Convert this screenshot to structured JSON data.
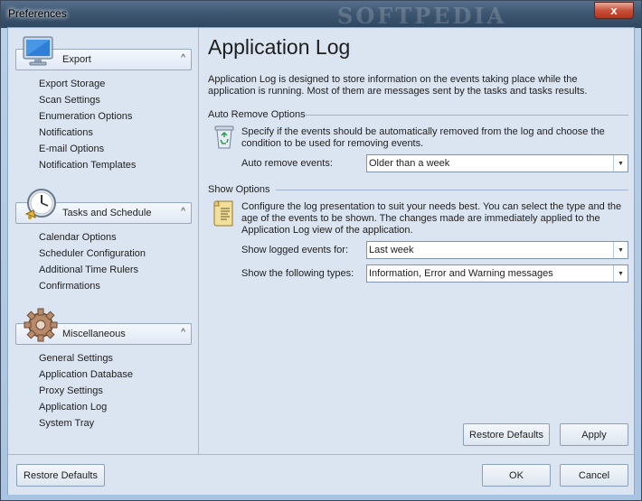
{
  "window": {
    "title": "Preferences",
    "watermark": "SOFTPEDIA",
    "close_glyph": "x"
  },
  "sidebar": {
    "groups": [
      {
        "label": "Export",
        "icon": "monitor-icon",
        "items": [
          "Export Storage",
          "Scan Settings",
          "Enumeration Options",
          "Notifications",
          "E-mail Options",
          "Notification Templates"
        ]
      },
      {
        "label": "Tasks and Schedule",
        "icon": "clock-icon",
        "items": [
          "Calendar Options",
          "Scheduler Configuration",
          "Additional Time Rulers",
          "Confirmations"
        ]
      },
      {
        "label": "Miscellaneous",
        "icon": "gear-icon",
        "items": [
          "General Settings",
          "Application Database",
          "Proxy Settings",
          "Application Log",
          "System Tray"
        ]
      }
    ],
    "chevron": "^"
  },
  "main": {
    "title": "Application Log",
    "description": "Application Log is designed to store information on the events taking place while the application is running. Most of them are messages sent by the tasks and tasks results.",
    "auto_remove": {
      "section_title": "Auto Remove Options",
      "icon": "recycle-bin-icon",
      "description": "Specify if the events should be automatically removed from the log and choose the condition to be used for removing events.",
      "field_label": "Auto remove events:",
      "value": "Older than a week"
    },
    "show_options": {
      "section_title": "Show Options",
      "icon": "log-scroll-icon",
      "description": "Configure the log presentation to suit your needs best. You can select the type and the age of the events to be shown. The changes made are immediately applied to the Application Log view of the application.",
      "logged_label": "Show logged events for:",
      "logged_value": "Last week",
      "types_label": "Show the following types:",
      "types_value": "Information, Error and Warning messages"
    },
    "restore_defaults": "Restore Defaults",
    "apply": "Apply"
  },
  "footer": {
    "restore_defaults": "Restore Defaults",
    "ok": "OK",
    "cancel": "Cancel"
  },
  "colors": {
    "panel": "#dbe5f1",
    "titlebar": "#3e5670",
    "close": "#c7513b"
  }
}
